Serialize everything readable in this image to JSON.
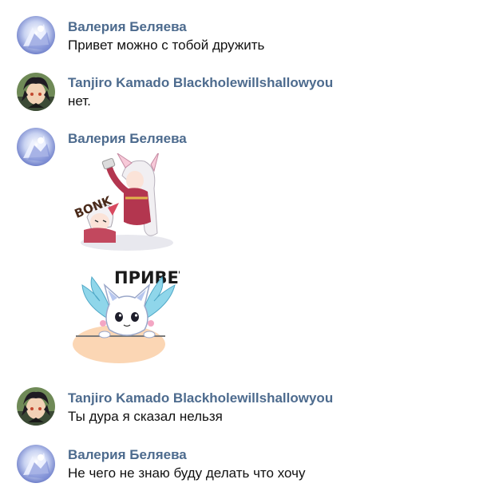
{
  "messages": [
    {
      "author": "Валерия Беляева",
      "text": "Привет можно с тобой дружить"
    },
    {
      "author": "Tanjiro Kamado Blackholewillshallowyou",
      "text": "нет."
    },
    {
      "author": "Валерия Беляева",
      "stickers": [
        {
          "caption": "BONK",
          "icon": "anime-bonk-sticker"
        },
        {
          "caption": "ПРИВЕТ",
          "icon": "winged-cat-sticker"
        }
      ]
    },
    {
      "author": "Tanjiro Kamado Blackholewillshallowyou",
      "text": "Ты дура я сказал нельзя"
    },
    {
      "author": "Валерия Беляева",
      "text": "Не чего не знаю буду делать что хочу"
    }
  ],
  "colors": {
    "author_name": "#4d6b8e",
    "message_text": "#111111",
    "background": "#ffffff"
  }
}
